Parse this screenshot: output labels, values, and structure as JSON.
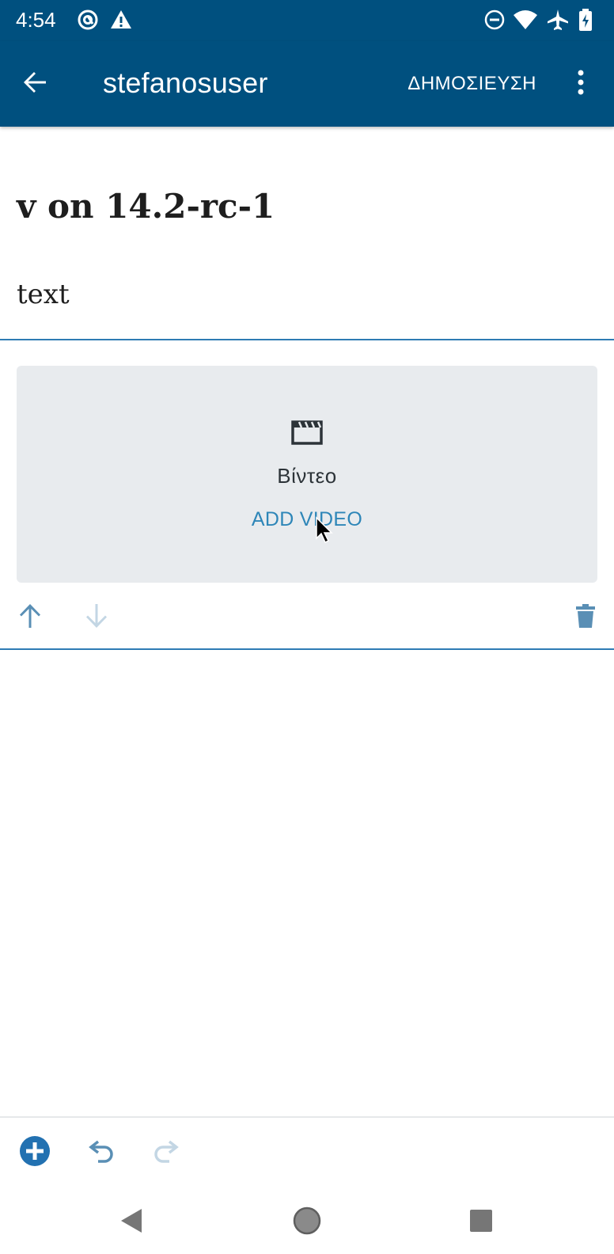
{
  "status_bar": {
    "time": "4:54",
    "left_icons": [
      "at-sign-icon",
      "warning-icon"
    ],
    "right_icons": [
      "do-not-disturb-icon",
      "wifi-icon",
      "airplane-icon",
      "battery-charging-icon"
    ]
  },
  "app_bar": {
    "title": "stefanosuser",
    "publish_label": "ΔΗΜΟΣΙΕΥΣΗ",
    "background": "#00507f"
  },
  "post": {
    "title": "v on 14.2-rc-1",
    "paragraph": "text"
  },
  "video_block": {
    "label": "Βίντεο",
    "add_button_label": "ADD VIDEO",
    "accent": "#2e86b8"
  },
  "block_toolbar": {
    "icons": [
      "arrow-up-icon",
      "arrow-down-icon",
      "trash-icon"
    ]
  },
  "bottom_toolbar": {
    "icons": [
      "add-block-icon",
      "undo-icon",
      "redo-icon"
    ]
  },
  "nav_bar": {
    "icons": [
      "back-triangle-icon",
      "home-circle-icon",
      "recents-square-icon"
    ]
  }
}
